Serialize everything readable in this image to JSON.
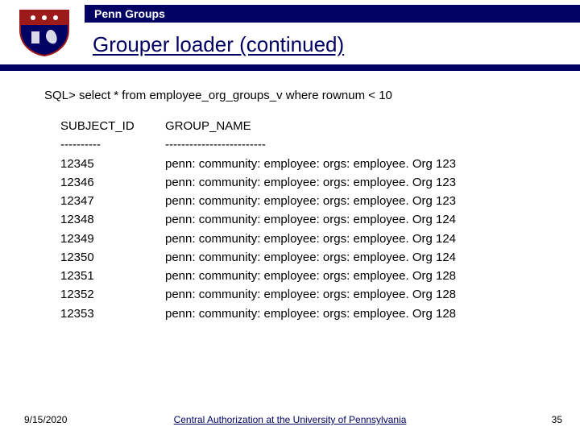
{
  "header": {
    "band_text": "Penn Groups"
  },
  "title": "Grouper loader (continued)",
  "sql_line": "SQL> select * from employee_org_groups_v where rownum < 10",
  "columns": {
    "id_header": "SUBJECT_ID",
    "name_header": "GROUP_NAME",
    "id_sep": "----------",
    "name_sep": "-------------------------"
  },
  "rows": [
    {
      "id": "12345",
      "name": "penn: community: employee: orgs: employee. Org 123"
    },
    {
      "id": "12346",
      "name": "penn: community: employee: orgs: employee. Org 123"
    },
    {
      "id": "12347",
      "name": "penn: community: employee: orgs: employee. Org 123"
    },
    {
      "id": "12348",
      "name": "penn: community: employee: orgs: employee. Org 124"
    },
    {
      "id": "12349",
      "name": "penn: community: employee: orgs: employee. Org 124"
    },
    {
      "id": "12350",
      "name": "penn: community: employee: orgs: employee. Org 124"
    },
    {
      "id": "12351",
      "name": "penn: community: employee: orgs: employee. Org 128"
    },
    {
      "id": "12352",
      "name": "penn: community: employee: orgs: employee. Org 128"
    },
    {
      "id": "12353",
      "name": "penn: community: employee: orgs: employee. Org 128"
    }
  ],
  "footer": {
    "date": "9/15/2020",
    "center": "Central Authorization at the University of Pennsylvania",
    "page": "35"
  }
}
